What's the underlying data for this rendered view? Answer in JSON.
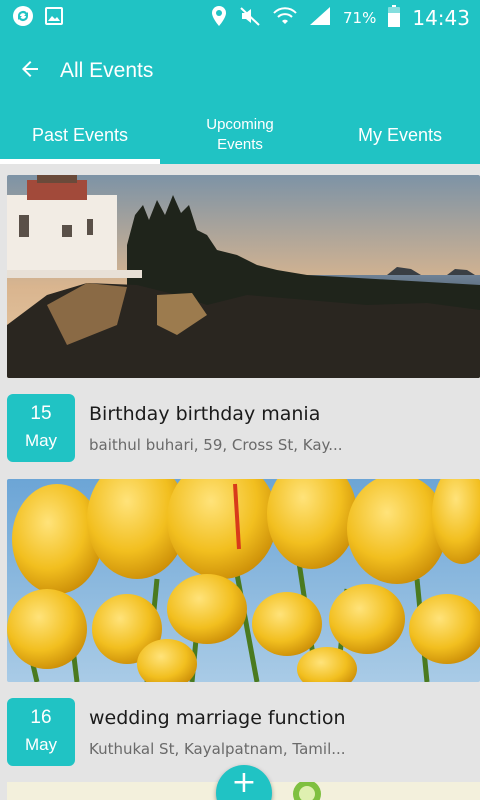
{
  "status_bar": {
    "battery_percent": "71%",
    "time": "14:43",
    "icons": [
      "sync-icon",
      "image-icon",
      "location-icon",
      "mute-icon",
      "wifi-icon",
      "signal-icon",
      "battery-icon"
    ]
  },
  "app_bar": {
    "title": "All Events",
    "back_icon": "arrow-left-icon"
  },
  "tabs": [
    {
      "label": "Past Events",
      "active": true
    },
    {
      "label": "Upcoming Events",
      "active": false
    },
    {
      "label": "My Events",
      "active": false
    }
  ],
  "events": [
    {
      "day": "15",
      "month": "May",
      "title": "Birthday birthday mania",
      "address": "baithul buhari, 59, Cross St, Kay...",
      "image": "lighthouse-coast-photo"
    },
    {
      "day": "16",
      "month": "May",
      "title": "wedding marriage function",
      "address": "Kuthukal St, Kayalpatnam, Tamil...",
      "image": "yellow-tulips-photo"
    }
  ],
  "fab": {
    "label": "+",
    "icon": "plus-icon"
  },
  "colors": {
    "accent": "#20c3c4",
    "background": "#e4e4e4"
  }
}
